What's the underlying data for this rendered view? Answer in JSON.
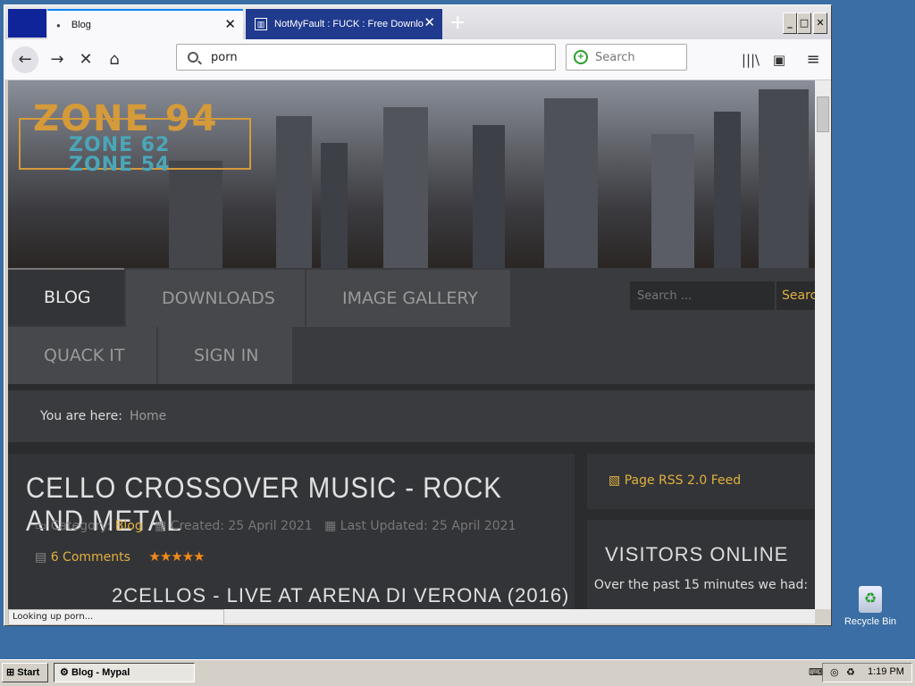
{
  "browser": {
    "tabs": [
      {
        "title": "Blog",
        "active": true
      },
      {
        "title": "NotMyFault : FUCK : Free Downlo",
        "active": false
      }
    ],
    "new_tab_symbol": "+",
    "url_text": "porn",
    "search_placeholder": "Search",
    "status_text": "Looking up porn..."
  },
  "site": {
    "logo_main": "ZONE 94",
    "logo_sub1": "ZONE 62",
    "logo_sub2": "ZONE 54",
    "menu": [
      "BLOG",
      "DOWNLOADS",
      "IMAGE GALLERY",
      "QUACK IT",
      "SIGN IN"
    ],
    "search_placeholder": "Search ...",
    "search_button": "Search",
    "breadcrumb_label": "You are here:",
    "breadcrumb_home": "Home",
    "article_title": "CELLO CROSSOVER MUSIC - ROCK AND METAL",
    "category_label": "Category:",
    "category_value": "Blog",
    "created": "Created: 25 April 2021",
    "updated": "Last Updated: 25 April 2021",
    "comments": "6 Comments",
    "stars": "★★★★★",
    "subtitle": "2CELLOS - LIVE AT ARENA DI VERONA (2016)",
    "rss": "Page RSS 2.0 Feed",
    "visitors_title": "VISITORS ONLINE",
    "visitors_text": "Over the past 15 minutes we had:"
  },
  "desktop": {
    "recycle_bin": "Recycle Bin",
    "start": "Start",
    "task": "Blog - Mypal",
    "clock": "1:19 PM"
  },
  "colors": {
    "accent": "#e0b040",
    "tab_active_border": "#0a84ff",
    "desktop": "#3a6ea5"
  }
}
